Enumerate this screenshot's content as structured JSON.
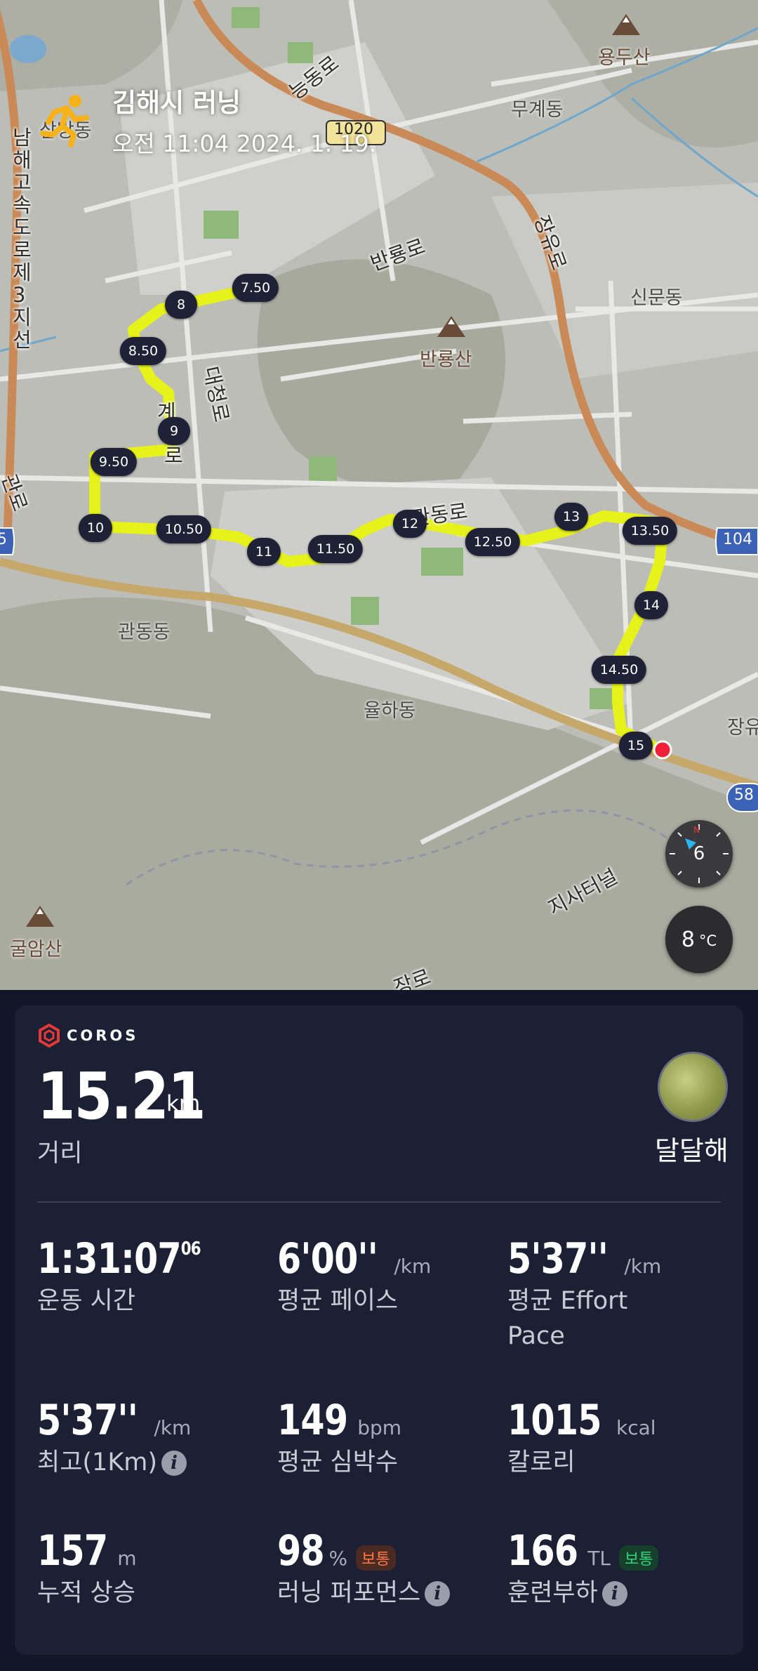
{
  "header": {
    "title": "김해시 러닝",
    "datetime": "오전 11:04 2024. 1. 19."
  },
  "map": {
    "places": {
      "yongdusan": "용두산",
      "mugyedong": "무계동",
      "sinmundong": "신문동",
      "banryongsan": "반룡산",
      "gwandongdong": "관동동",
      "yulhadong": "율하동",
      "gulamsan": "굴암산",
      "sambangdong": "삼방동",
      "jangyu": "장유"
    },
    "roads": {
      "neungdongro": "능동로",
      "banryongro": "반룡로",
      "jangyuro": "장유로",
      "daecheongro": "대청로",
      "gwandongro": "관동로",
      "expressway": "남해고속도로제3지선",
      "tunnel": "지사터널",
      "gyero": "계",
      "gyero2": "로",
      "jangro": "장로",
      "gwanro": "관로"
    },
    "shields": {
      "r1020": "1020",
      "r104": "104",
      "r58": "58",
      "r5": "5"
    },
    "markers": [
      "7.50",
      "8",
      "8.50",
      "9",
      "9.50",
      "10",
      "10.50",
      "11",
      "11.50",
      "12",
      "12.50",
      "13",
      "13.50",
      "14",
      "14.50",
      "15"
    ],
    "compass_value": "6",
    "temperature": "8",
    "temperature_unit": "°C",
    "route_color": "#e6f21a",
    "marker_color": "#1f2236"
  },
  "summary": {
    "brand": "COROS",
    "distance": "15.21",
    "distance_unit": "km",
    "distance_label": "거리",
    "user_name": "달달해"
  },
  "stats": {
    "time": {
      "value": "1:31:07",
      "sub": "06",
      "label": "운동 시간"
    },
    "avg_pace": {
      "value": "6'00''",
      "unit": "/km",
      "label": "평균 페이스"
    },
    "effort_pace": {
      "value": "5'37''",
      "unit": "/km",
      "label": "평균 Effort Pace"
    },
    "best_km": {
      "value": "5'37''",
      "unit": "/km",
      "label": "최고(1Km)"
    },
    "heart_rate": {
      "value": "149",
      "unit": "bpm",
      "label": "평균 심박수"
    },
    "calories": {
      "value": "1015",
      "unit": "kcal",
      "label": "칼로리"
    },
    "elevation": {
      "value": "157",
      "unit": "m",
      "label": "누적 상승"
    },
    "performance": {
      "value": "98",
      "unit": "%",
      "badge": "보통",
      "label": "러닝 퍼포먼스"
    },
    "training_load": {
      "value": "166",
      "unit": "TL",
      "badge": "보통",
      "label": "훈련부하"
    }
  },
  "colors": {
    "card_bg": "#1b2035",
    "badge_orange": "#ff7a45",
    "badge_green": "#2fd37a"
  }
}
